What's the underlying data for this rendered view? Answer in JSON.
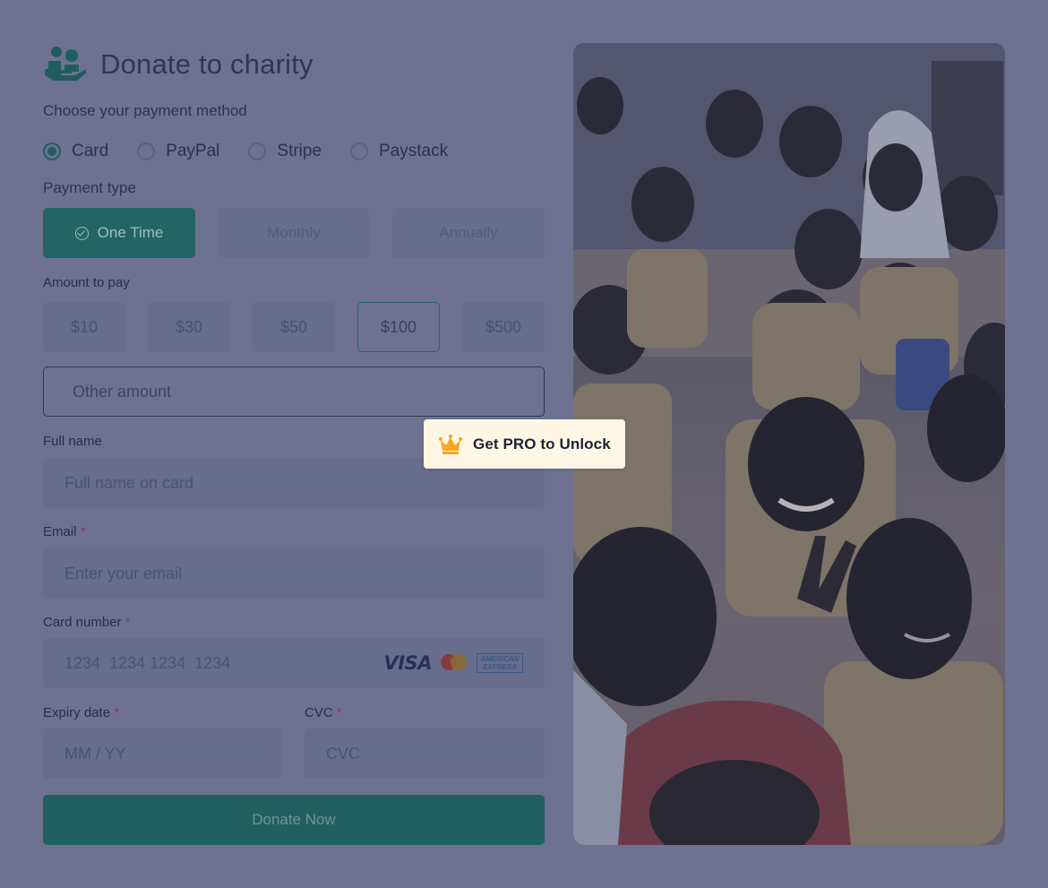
{
  "header": {
    "title": "Donate to charity",
    "logo_icon": "charity-hands-icon"
  },
  "payment_method": {
    "label": "Choose your payment method",
    "options": [
      {
        "label": "Card",
        "checked": true
      },
      {
        "label": "PayPal",
        "checked": false
      },
      {
        "label": "Stripe",
        "checked": false
      },
      {
        "label": "Paystack",
        "checked": false
      }
    ]
  },
  "payment_type": {
    "label": "Payment type",
    "options": [
      {
        "label": "One Time",
        "active": true
      },
      {
        "label": "Monthly",
        "active": false
      },
      {
        "label": "Annually",
        "active": false
      }
    ]
  },
  "amount": {
    "label": "Amount to pay",
    "options": [
      {
        "label": "$10",
        "active": false
      },
      {
        "label": "$30",
        "active": false
      },
      {
        "label": "$50",
        "active": false
      },
      {
        "label": "$100",
        "active": true
      },
      {
        "label": "$500",
        "active": false
      }
    ],
    "other_placeholder": "Other amount"
  },
  "full_name": {
    "label": "Full name",
    "placeholder": "Full name on card"
  },
  "email": {
    "label": "Email",
    "required": "*",
    "placeholder": "Enter your email"
  },
  "card_number": {
    "label": "Card number",
    "required": "*",
    "placeholder": "1234  1234 1234  1234",
    "brands": {
      "visa": "VISA",
      "amex": "AMERICAN EXPRESS"
    }
  },
  "expiry": {
    "label": "Expiry date",
    "required": "*",
    "placeholder": "MM / YY"
  },
  "cvc": {
    "label": "CVC",
    "required": "*",
    "placeholder": "CVC"
  },
  "donate_button": "Donate Now",
  "pro_badge": {
    "label": "Get PRO to Unlock",
    "icon": "crown-icon"
  },
  "colors": {
    "accent": "#236464",
    "overlay": "#6e7290",
    "badge_bg": "#fff7e6",
    "crown": "#f5a623"
  }
}
